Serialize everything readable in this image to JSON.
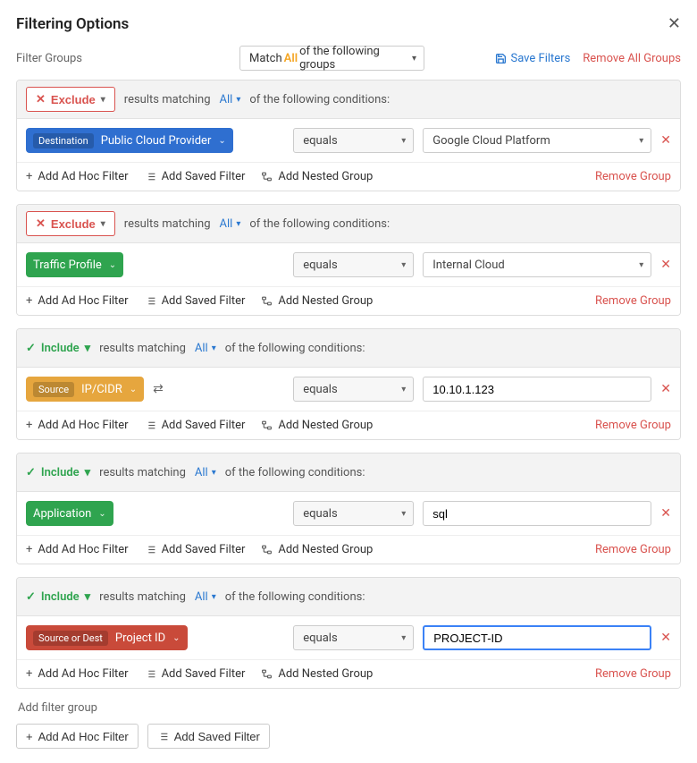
{
  "title": "Filtering Options",
  "close_icon": "close-icon",
  "filter_groups_label": "Filter Groups",
  "match": {
    "prefix": "Match",
    "mode": "All",
    "suffix": "of the following groups"
  },
  "save_filters": "Save Filters",
  "remove_all": "Remove All Groups",
  "results_matching": "results matching",
  "all_label": "All",
  "of_following": "of the following conditions:",
  "add_adhoc": "Add Ad Hoc Filter",
  "add_saved": "Add Saved Filter",
  "add_nested": "Add Nested Group",
  "remove_group": "Remove Group",
  "add_filter_group": "Add filter group",
  "groups": [
    {
      "mode": "Exclude",
      "chip": {
        "tag": "Destination",
        "label": "Public Cloud Provider",
        "color": "blue",
        "swap": false
      },
      "op": "equals",
      "value_type": "select",
      "value": "Google Cloud Platform"
    },
    {
      "mode": "Exclude",
      "chip": {
        "tag": null,
        "label": "Traffic Profile",
        "color": "green",
        "swap": false
      },
      "op": "equals",
      "value_type": "select",
      "value": "Internal Cloud"
    },
    {
      "mode": "Include",
      "chip": {
        "tag": "Source",
        "label": "IP/CIDR",
        "color": "amber",
        "swap": true
      },
      "op": "equals",
      "value_type": "input",
      "value": "10.10.1.123"
    },
    {
      "mode": "Include",
      "chip": {
        "tag": null,
        "label": "Application",
        "color": "green",
        "swap": false
      },
      "op": "equals",
      "value_type": "input",
      "value": "sql"
    },
    {
      "mode": "Include",
      "chip": {
        "tag": "Source or Dest",
        "label": "Project ID",
        "color": "red",
        "swap": false
      },
      "op": "equals",
      "value_type": "input-focus",
      "value": "PROJECT-ID"
    }
  ]
}
